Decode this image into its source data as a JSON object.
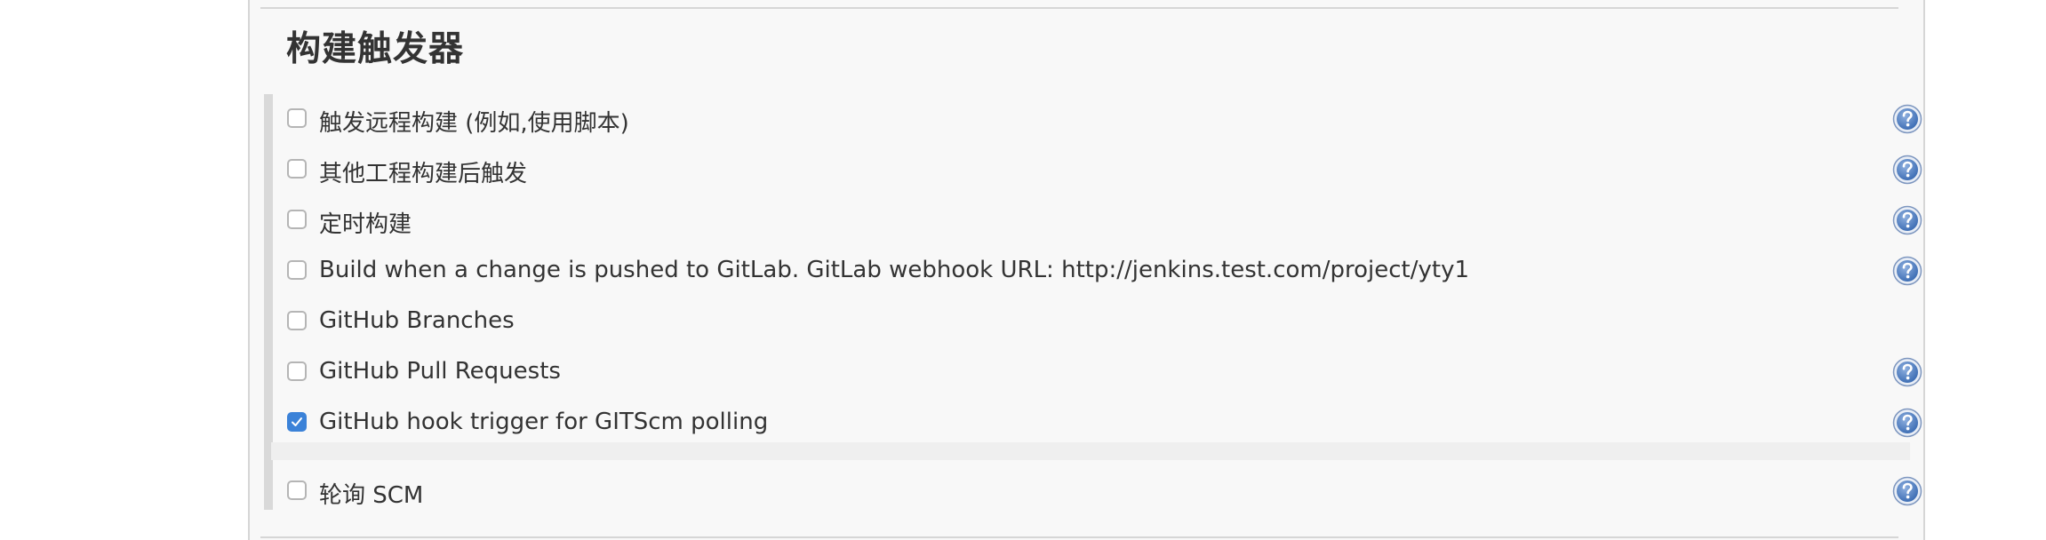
{
  "section": {
    "title": "构建触发器"
  },
  "triggers": [
    {
      "label": "触发远程构建 (例如,使用脚本)",
      "checked": false,
      "help": true
    },
    {
      "label": "其他工程构建后触发",
      "checked": false,
      "help": true
    },
    {
      "label": "定时构建",
      "checked": false,
      "help": true
    },
    {
      "label": "Build when a change is pushed to GitLab. GitLab webhook URL: http://jenkins.test.com/project/yty1",
      "checked": false,
      "help": true
    },
    {
      "label": "GitHub Branches",
      "checked": false,
      "help": false
    },
    {
      "label": "GitHub Pull Requests",
      "checked": false,
      "help": true
    },
    {
      "label": "GitHub hook trigger for GITScm polling",
      "checked": true,
      "help": true
    },
    {
      "label": "轮询 SCM",
      "checked": false,
      "help": true
    }
  ],
  "colors": {
    "checkbox_checked": "#3b82d8",
    "help_icon": "#3f6fb5"
  },
  "icons": {
    "help": "help-icon",
    "check": "check-icon"
  }
}
